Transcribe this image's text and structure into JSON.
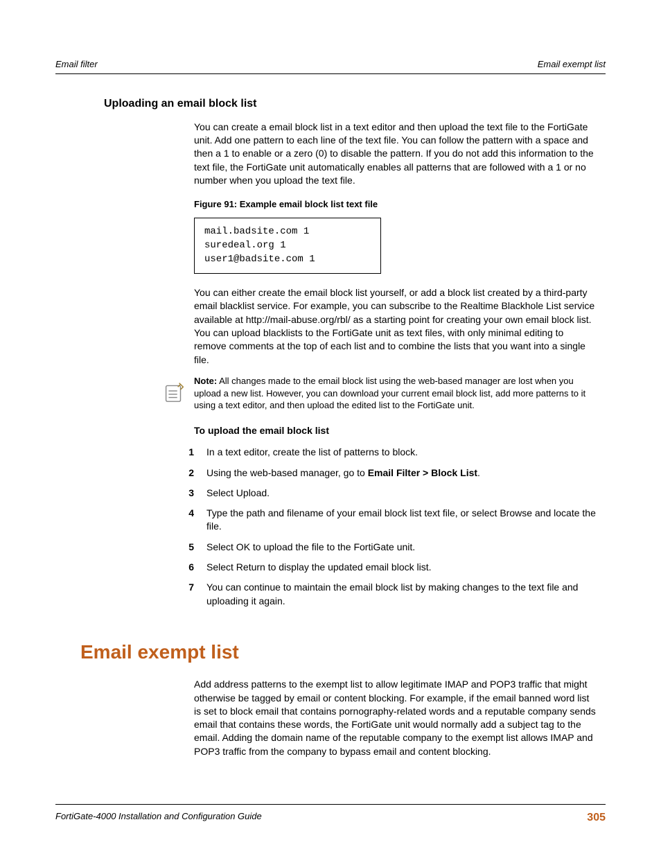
{
  "header": {
    "left": "Email filter",
    "right": "Email exempt list"
  },
  "section1": {
    "heading": "Uploading an email block list",
    "para1": "You can create a email block list in a text editor and then upload the text file to the FortiGate unit. Add one pattern to each line of the text file. You can follow the pattern with a space and then a 1 to enable or a zero (0) to disable the pattern. If you do not add this information to the text file, the FortiGate unit automatically enables all patterns that are followed with a 1 or no number when you upload the text file.",
    "fig_caption": "Figure 91: Example email block list text file",
    "code": "mail.badsite.com 1\nsuredeal.org 1\nuser1@badsite.com 1",
    "para2": "You can either create the email block list yourself, or add a block list created by a third-party email blacklist service. For example, you can subscribe to the Realtime Blackhole List service available at http://mail-abuse.org/rbl/ as a starting point for creating your own email block list. You can upload blacklists to the FortiGate unit as text files, with only minimal editing to remove comments at the top of each list and to combine the lists that you want into a single file.",
    "note_label": "Note:",
    "note_text": " All changes made to the email block list using the web-based manager are lost when you upload a new list. However, you can download your current email block list, add more patterns to it using a text editor, and then upload the edited list to the FortiGate unit.",
    "proc_heading": "To upload the email block list",
    "steps": [
      "In a text editor, create the list of patterns to block.",
      "Using the web-based manager, go to ",
      "Select Upload.",
      "Type the path and filename of your email block list text file, or select Browse and locate the file.",
      "Select OK to upload the file to the FortiGate unit.",
      "Select Return to display the updated email block list.",
      "You can continue to maintain the email block list by making changes to the text file and uploading it again."
    ],
    "step2_bold": "Email Filter > Block List",
    "step2_suffix": "."
  },
  "section2": {
    "heading": "Email exempt list",
    "para": "Add address patterns to the exempt list to allow legitimate IMAP and POP3 traffic that might otherwise be tagged by email or content blocking. For example, if the email banned word list is set to block email that contains pornography-related words and a reputable company sends email that contains these words, the FortiGate unit would normally add a subject tag to the email. Adding the domain name of the reputable company to the exempt list allows IMAP and POP3 traffic from the company to bypass email and content blocking."
  },
  "footer": {
    "left": "FortiGate-4000 Installation and Configuration Guide",
    "page": "305"
  }
}
